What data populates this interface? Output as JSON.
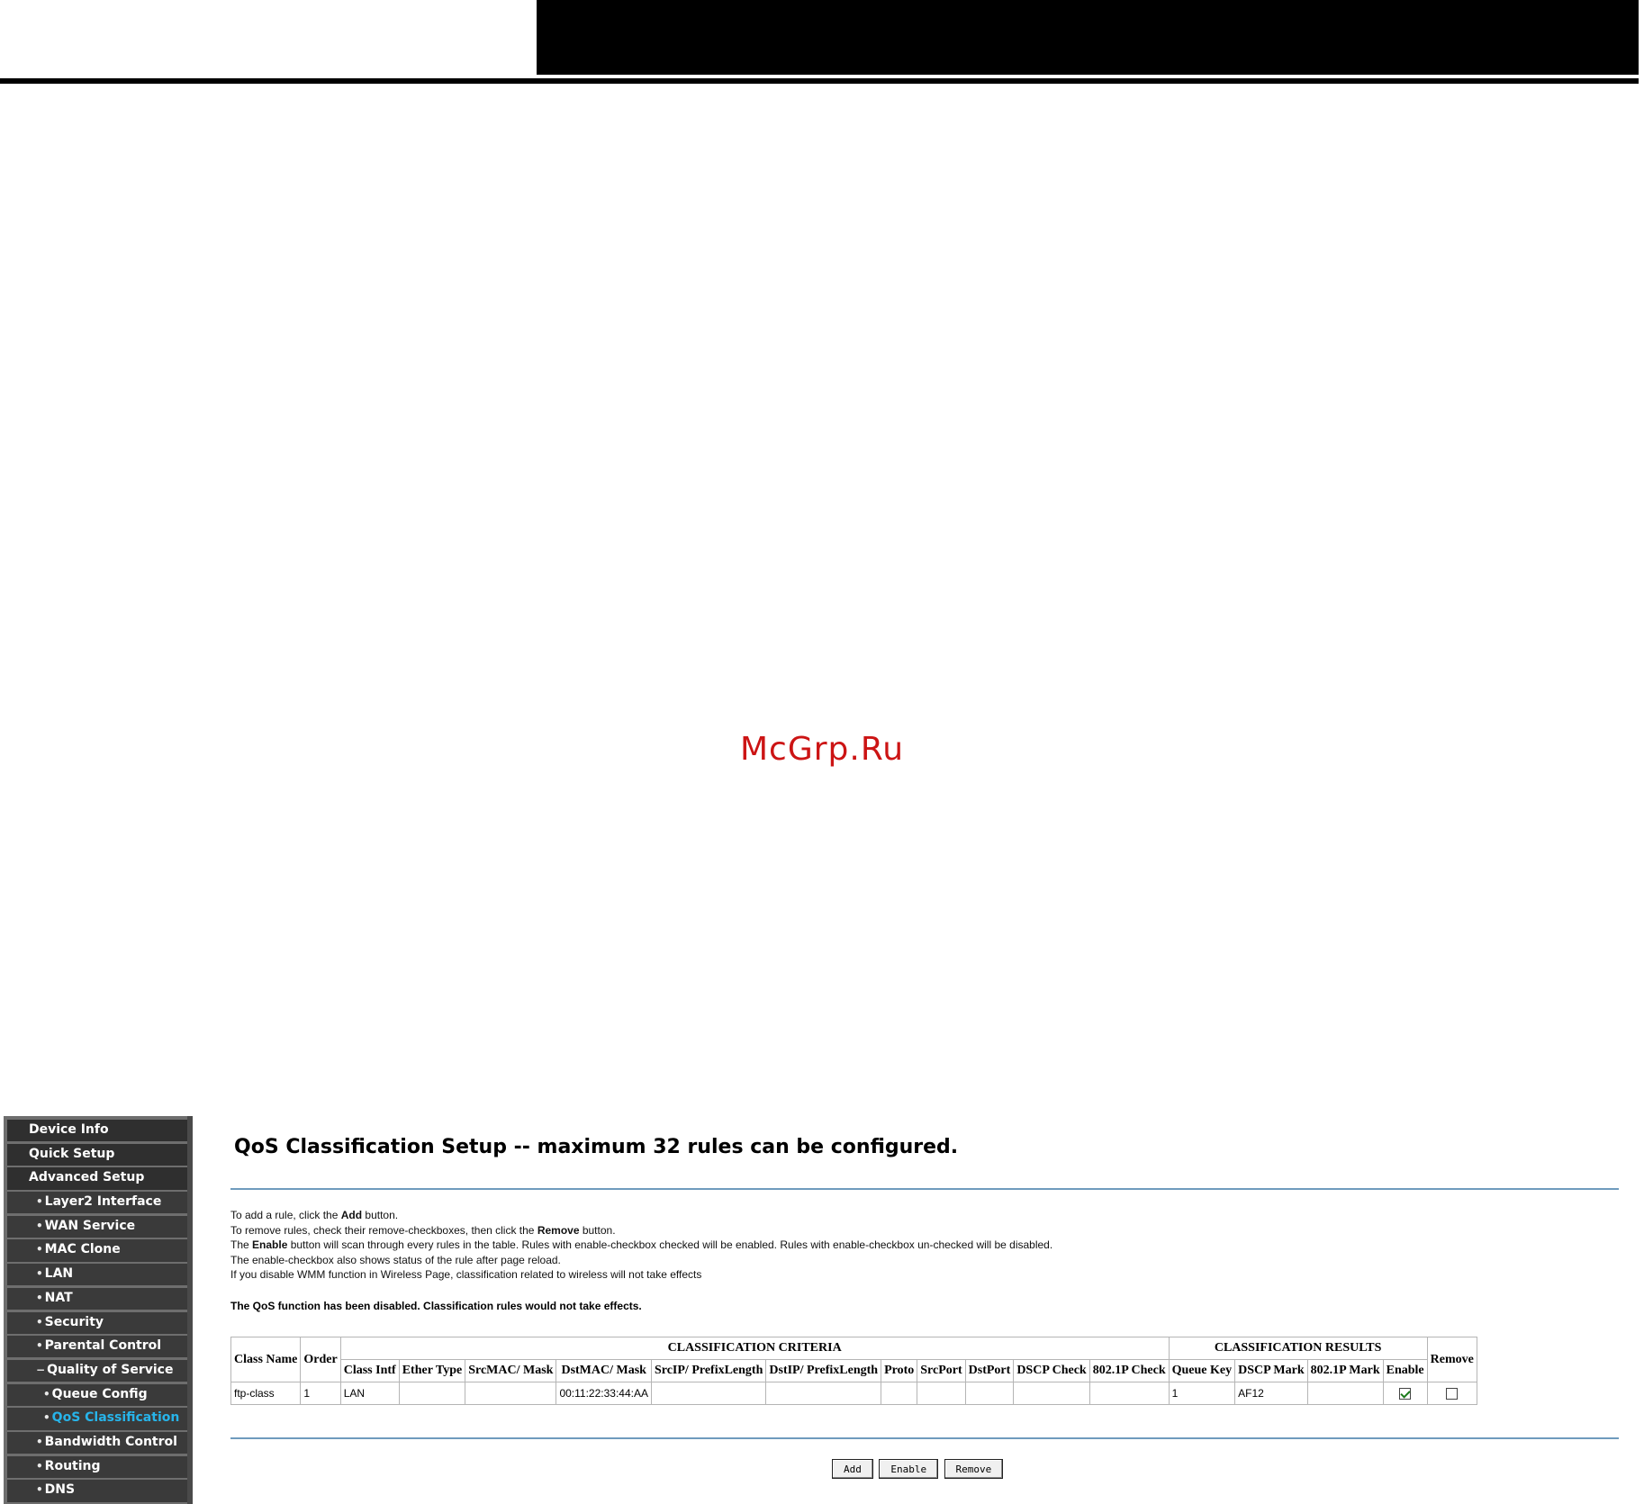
{
  "watermark": "McGrp.Ru",
  "nav": {
    "items": [
      {
        "label": "Device Info",
        "level": "top",
        "active": false
      },
      {
        "label": "Quick Setup",
        "level": "top",
        "active": false
      },
      {
        "label": "Advanced Setup",
        "level": "top",
        "active": false
      },
      {
        "label": "Layer2 Interface",
        "level": "sub",
        "active": false
      },
      {
        "label": "WAN Service",
        "level": "sub",
        "active": false
      },
      {
        "label": "MAC Clone",
        "level": "sub",
        "active": false
      },
      {
        "label": "LAN",
        "level": "sub",
        "active": false
      },
      {
        "label": "NAT",
        "level": "sub",
        "active": false
      },
      {
        "label": "Security",
        "level": "sub",
        "active": false
      },
      {
        "label": "Parental Control",
        "level": "sub",
        "active": false
      },
      {
        "label": "Quality of Service",
        "level": "sub",
        "active": false,
        "expanded": true
      },
      {
        "label": "Queue Config",
        "level": "sub2",
        "active": false
      },
      {
        "label": "QoS Classification",
        "level": "sub2",
        "active": true
      },
      {
        "label": "Bandwidth Control",
        "level": "sub",
        "active": false
      },
      {
        "label": "Routing",
        "level": "sub",
        "active": false
      },
      {
        "label": "DNS",
        "level": "sub",
        "active": false
      }
    ]
  },
  "page": {
    "title": "QoS Classification Setup -- maximum 32 rules can be configured.",
    "desc": {
      "l1a": "To add a rule, click the ",
      "l1b": "Add",
      "l1c": " button.",
      "l2a": "To remove rules, check their remove-checkboxes, then click the ",
      "l2b": "Remove",
      "l2c": " button.",
      "l3a": "The ",
      "l3b": "Enable",
      "l3c": " button will scan through every rules in the table. Rules with enable-checkbox checked will be enabled. Rules with enable-checkbox un-checked will be disabled.",
      "l4": "The enable-checkbox also shows status of the rule after page reload.",
      "l5": "If you disable WMM function in Wireless Page, classification related to wireless will not take effects"
    },
    "warning": "The QoS function has been disabled. Classification rules would not take effects."
  },
  "table": {
    "group_criteria": "CLASSIFICATION CRITERIA",
    "group_results": "CLASSIFICATION RESULTS",
    "col_class_name": "Class Name",
    "col_order": "Order",
    "col_remove": "Remove",
    "criteria_columns": [
      "Class Intf",
      "Ether Type",
      "SrcMAC/ Mask",
      "DstMAC/ Mask",
      "SrcIP/ PrefixLength",
      "DstIP/ PrefixLength",
      "Proto",
      "SrcPort",
      "DstPort",
      "DSCP Check",
      "802.1P Check"
    ],
    "result_columns": [
      "Queue Key",
      "DSCP Mark",
      "802.1P Mark",
      "Enable"
    ],
    "rows": [
      {
        "class_name": "ftp-class",
        "order": "1",
        "criteria": [
          "LAN",
          "",
          "",
          "00:11:22:33:44:AA",
          "",
          "",
          "",
          "",
          "",
          "",
          ""
        ],
        "results": [
          "1",
          "AF12",
          ""
        ],
        "enable": true,
        "remove": false
      }
    ]
  },
  "buttons": {
    "add": "Add",
    "enable": "Enable",
    "remove": "Remove"
  }
}
